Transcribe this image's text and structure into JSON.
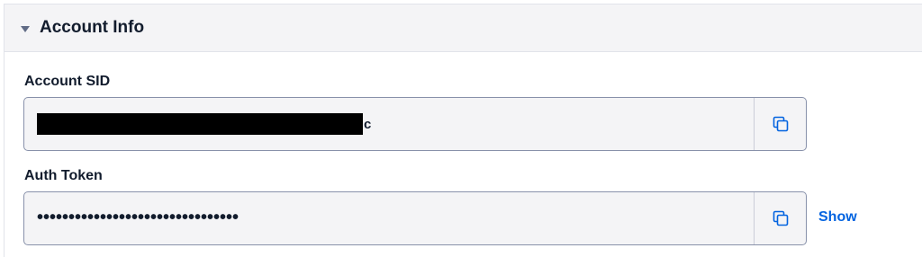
{
  "panel": {
    "title": "Account Info",
    "toggle_icon": "caret-down-icon"
  },
  "account_sid": {
    "label": "Account SID",
    "value_visible_tail": "c",
    "redacted": true,
    "copy_icon": "copy-icon"
  },
  "auth_token": {
    "label": "Auth Token",
    "value": "••••••••••••••••••••••••••••••••",
    "copy_icon": "copy-icon",
    "show_label": "Show"
  },
  "colors": {
    "header_bg": "#f4f4f6",
    "field_bg": "#f4f4f6",
    "field_border": "#8891aa",
    "link": "#0263e0",
    "icon": "#0263e0",
    "text": "#121c2d"
  }
}
